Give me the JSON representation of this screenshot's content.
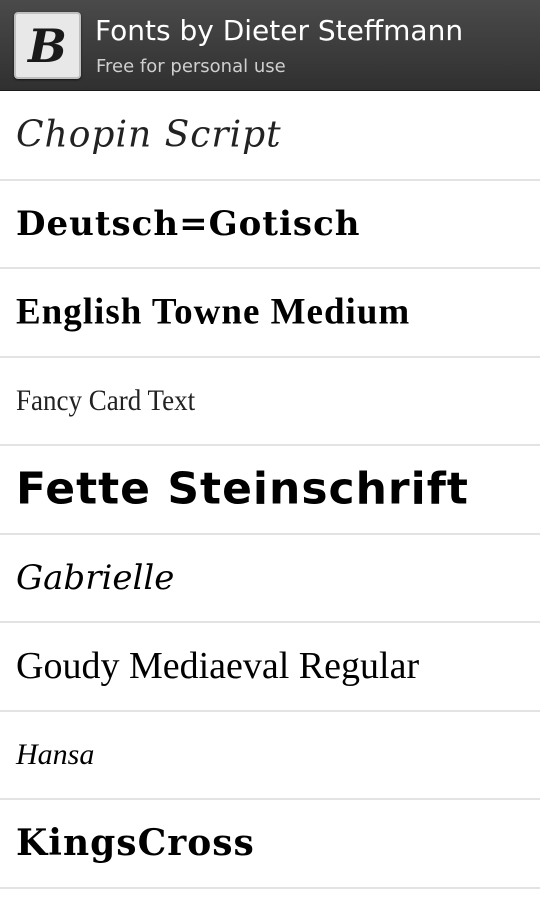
{
  "header": {
    "title": "Fonts by Dieter Steffmann",
    "subtitle": "Free for personal use",
    "icon": "blackletter-b-icon",
    "icon_letter": "B",
    "background_color": "#3a3a3a"
  },
  "fonts": [
    {
      "name": "Chopin Script"
    },
    {
      "name": "Deutsch=Gotisch"
    },
    {
      "name": "English Towne Medium"
    },
    {
      "name": "Fancy Card Text"
    },
    {
      "name": "Fette Steinschrift"
    },
    {
      "name": "Gabrielle"
    },
    {
      "name": "Goudy Mediaeval Regular"
    },
    {
      "name": "Hansa"
    },
    {
      "name": "KingsCross"
    }
  ]
}
